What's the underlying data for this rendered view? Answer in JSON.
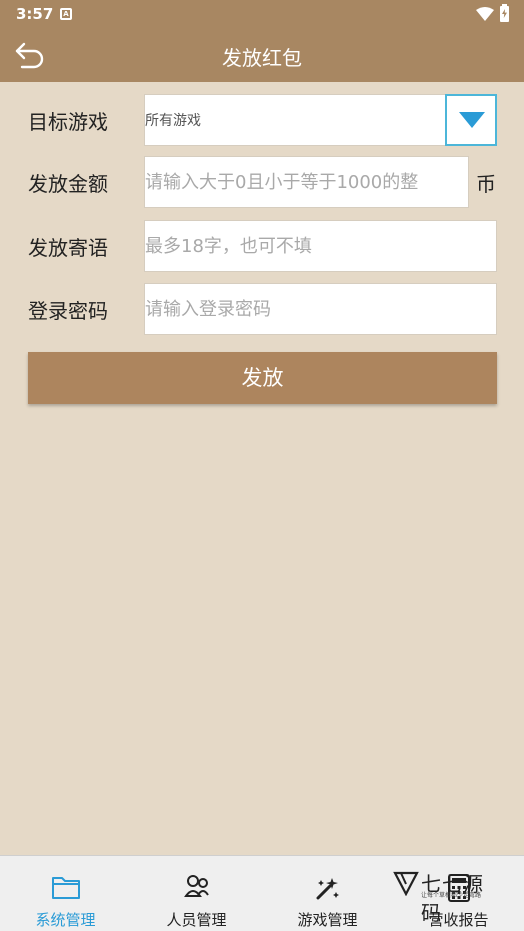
{
  "status_bar": {
    "time": "3:57",
    "notification_letter": "A"
  },
  "app_bar": {
    "title": "发放红包",
    "back_icon": "back-arrow-icon"
  },
  "form": {
    "target_game": {
      "label": "目标游戏",
      "value": "所有游戏",
      "dropdown_icon": "triangle-down-icon"
    },
    "amount": {
      "label": "发放金额",
      "placeholder": "请输入大于0且小于等于1000的整",
      "unit": "币"
    },
    "message": {
      "label": "发放寄语",
      "placeholder": "最多18字，也可不填"
    },
    "password": {
      "label": "登录密码",
      "placeholder": "请输入登录密码"
    },
    "submit_label": "发放"
  },
  "tabs": [
    {
      "label": "系统管理",
      "icon": "folder-icon",
      "active": true
    },
    {
      "label": "人员管理",
      "icon": "people-icon",
      "active": false
    },
    {
      "label": "游戏管理",
      "icon": "magic-wand-icon",
      "active": false
    },
    {
      "label": "营收报告",
      "icon": "calculator-icon",
      "active": false
    }
  ],
  "watermark": {
    "text": "七七源码",
    "subtext": "让每个草根都少走弯路"
  },
  "colors": {
    "header": "#a88762",
    "background": "#e5d9c7",
    "button": "#ad855e",
    "accent": "#2a9bd6",
    "dropdown_border": "#4cb6d9"
  }
}
